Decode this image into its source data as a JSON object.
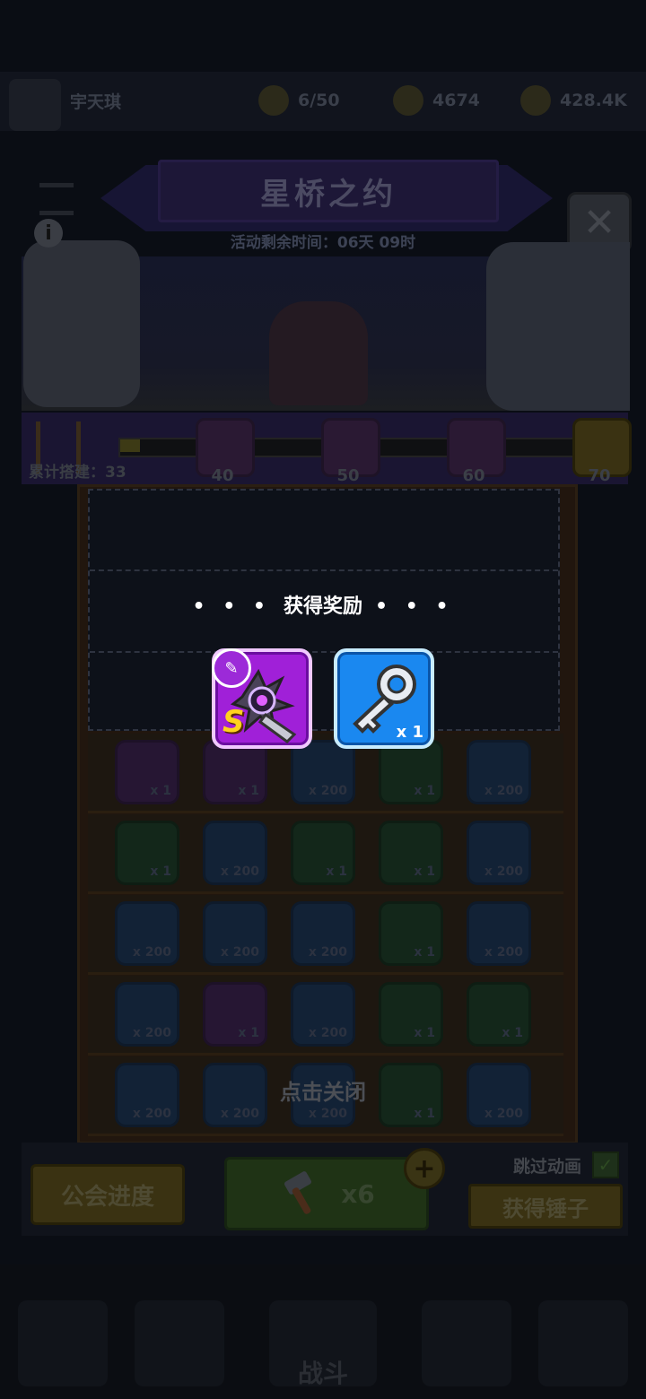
{
  "header": {
    "player_name": "宇天琪",
    "energy": "6/50",
    "gems": "4674",
    "coins": "428.4K"
  },
  "event": {
    "title": "星桥之约",
    "timer": "活动剩余时间：06天 09时"
  },
  "progress": {
    "accumulated_label": "累计搭建：33",
    "milestones": [
      "40",
      "50",
      "60",
      "70"
    ]
  },
  "reward_popup": {
    "title": "获得奖励",
    "items": [
      {
        "name": "weapon-s",
        "grade": "S",
        "qty": ""
      },
      {
        "name": "silver-key",
        "grade": "",
        "qty": "x 1"
      }
    ],
    "close_hint": "点击关闭"
  },
  "board": {
    "rows": [
      [
        "x 1",
        "x 1",
        "x 200",
        "x 1",
        "x 200"
      ],
      [
        "x 1",
        "x 200",
        "x 1",
        "x 1",
        "x 200"
      ],
      [
        "x 200",
        "x 200",
        "x 200",
        "x 1",
        "x 200"
      ],
      [
        "x 200",
        "x 1",
        "x 200",
        "x 1",
        "x 1"
      ],
      [
        "x 200",
        "x 200",
        "x 200",
        "x 1",
        "x 200"
      ]
    ]
  },
  "controls": {
    "guild_progress": "公会进度",
    "hammer_count": "x6",
    "skip_animation": "跳过动画",
    "get_hammer": "获得锤子"
  },
  "nav": {
    "battle": "战斗"
  }
}
